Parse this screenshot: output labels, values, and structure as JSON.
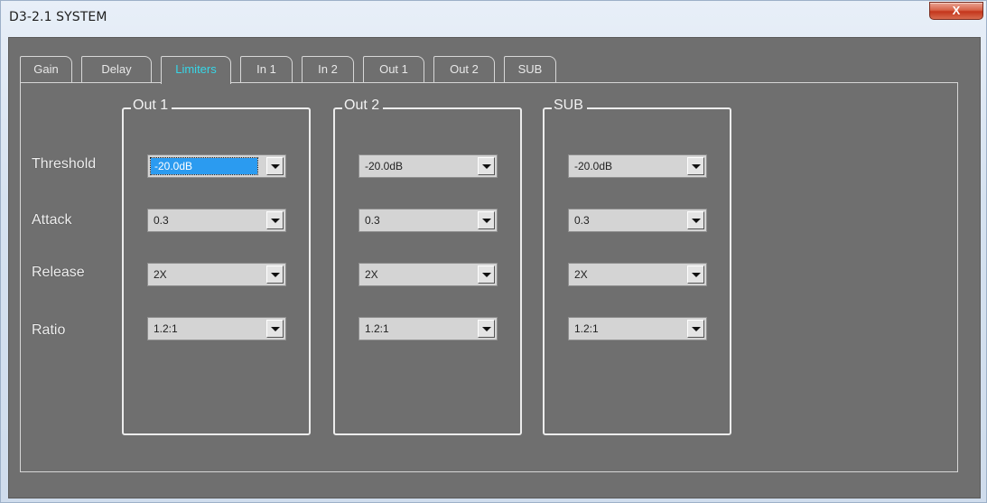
{
  "window": {
    "title": "D3-2.1 SYSTEM",
    "close_label": "X"
  },
  "tabs": [
    "Gain",
    "Delay",
    "Limiters",
    "In 1",
    "In 2",
    "Out 1",
    "Out 2",
    "SUB"
  ],
  "active_tab": "Limiters",
  "row_labels": [
    "Threshold",
    "Attack",
    "Release",
    "Ratio"
  ],
  "groups": [
    {
      "title": "Out 1",
      "threshold": "-20.0dB",
      "attack": "0.3",
      "release": "2X",
      "ratio": "1.2:1"
    },
    {
      "title": "Out 2",
      "threshold": "-20.0dB",
      "attack": "0.3",
      "release": "2X",
      "ratio": "1.2:1"
    },
    {
      "title": "SUB",
      "threshold": "-20.0dB",
      "attack": "0.3",
      "release": "2X",
      "ratio": "1.2:1"
    }
  ],
  "colors": {
    "panel_bg": "#6f6f6f",
    "active_tab_text": "#36d7e8",
    "selection": "#2b9bf0"
  },
  "icons": {
    "close": "close-icon",
    "dropdown": "chevron-down-icon"
  }
}
